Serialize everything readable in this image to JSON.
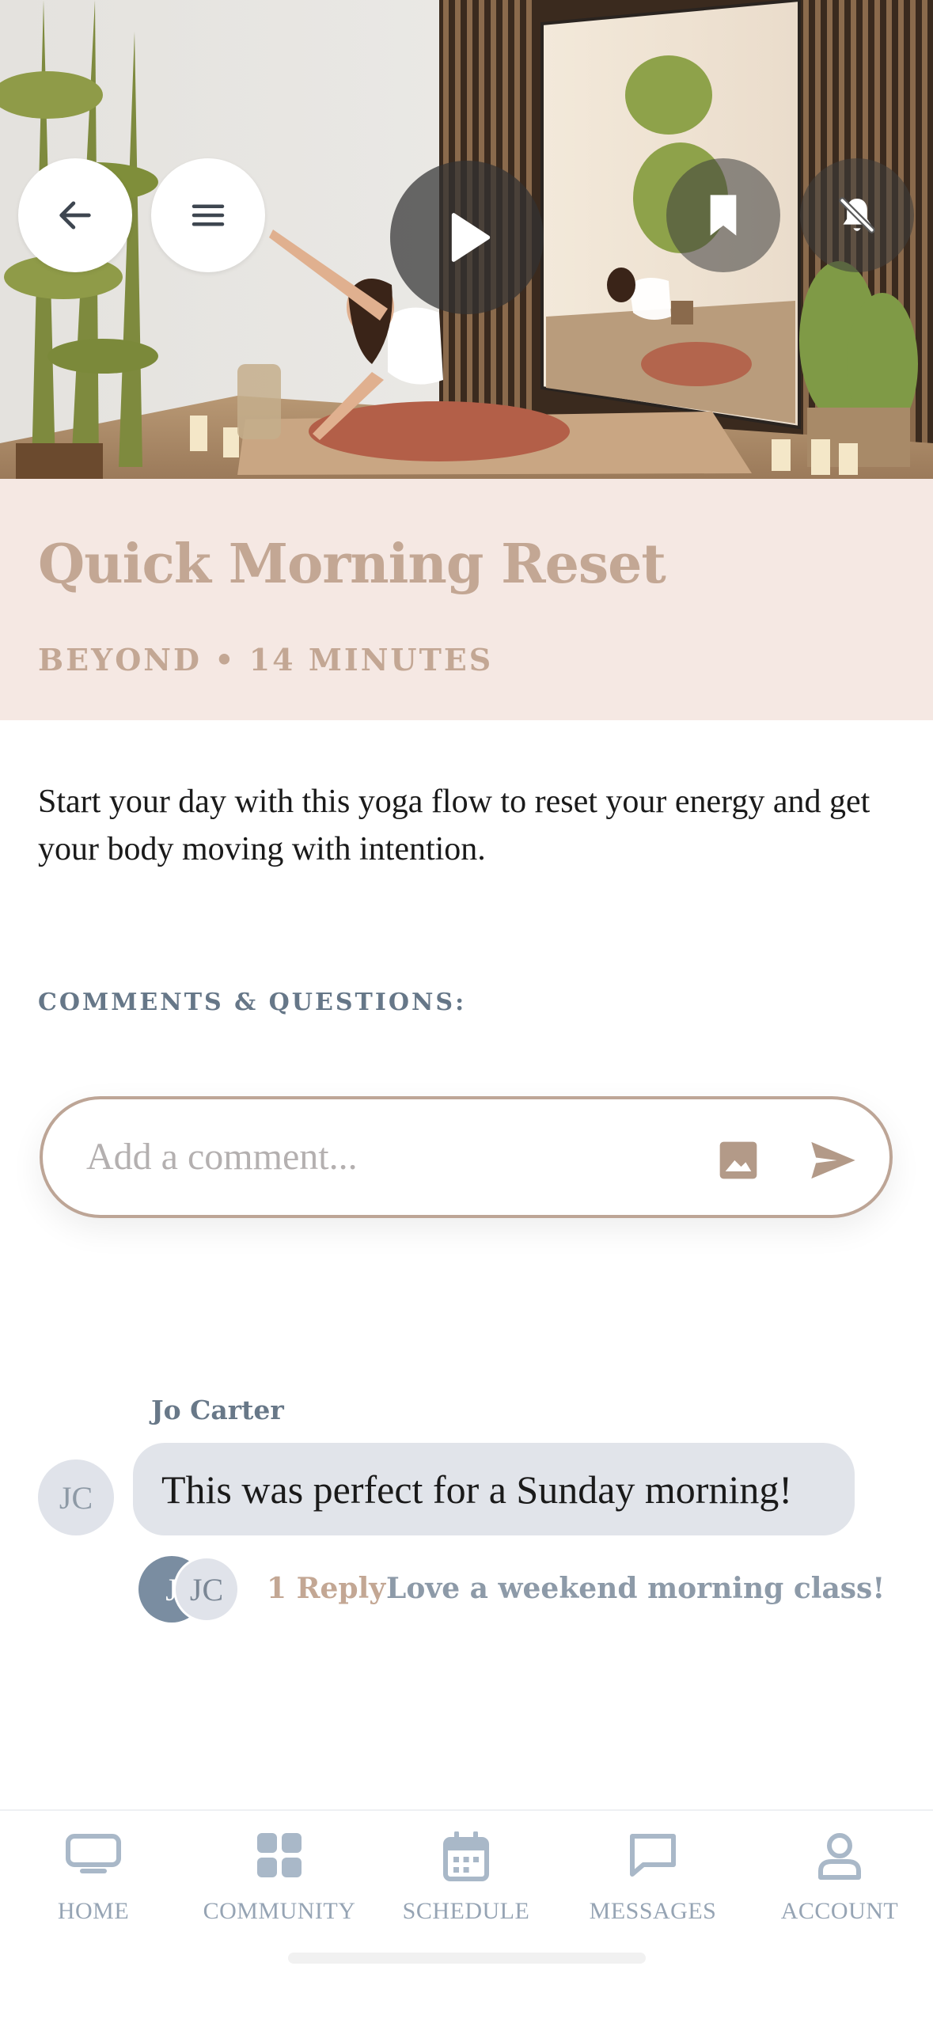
{
  "video": {
    "title": "Quick Morning Reset",
    "meta": "BEYOND • 14 MINUTES",
    "description": "Start your day with this yoga flow to reset your energy and get your body moving with intention."
  },
  "toolbar": {
    "back_icon": "arrow-left-icon",
    "menu_icon": "hamburger-menu-icon",
    "play_icon": "play-icon",
    "bookmark_icon": "bookmark-icon",
    "notifications_icon": "bell-off-icon"
  },
  "comments": {
    "section_label": "COMMENTS & QUESTIONS:",
    "input_placeholder": "Add a comment...",
    "items": [
      {
        "author": "Jo Carter",
        "initials": "JC",
        "text": "This was perfect for a Sunday morning!",
        "reply_avatars": [
          "J",
          "JC"
        ],
        "reply_count": "1 Reply",
        "reply_preview": "Love a weekend morning class! S..."
      }
    ]
  },
  "nav": {
    "items": [
      {
        "label": "HOME",
        "icon": "tv-icon"
      },
      {
        "label": "COMMUNITY",
        "icon": "grid-icon"
      },
      {
        "label": "SCHEDULE",
        "icon": "calendar-icon"
      },
      {
        "label": "MESSAGES",
        "icon": "chat-icon"
      },
      {
        "label": "ACCOUNT",
        "icon": "person-icon"
      }
    ]
  },
  "colors": {
    "accent": "#c3a794",
    "title_band": "#f5e8e3",
    "slate": "#667788",
    "bubble": "#e1e4ea"
  }
}
